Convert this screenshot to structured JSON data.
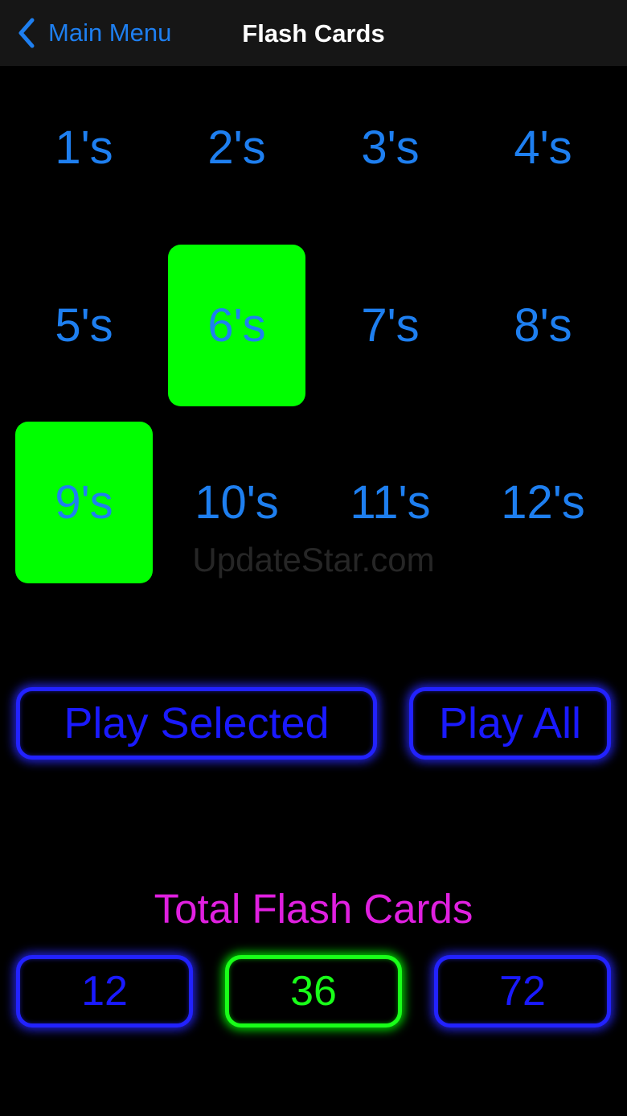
{
  "nav": {
    "back_label": "Main Menu",
    "back_icon": "chevron-left-icon",
    "title": "Flash Cards"
  },
  "tables": [
    {
      "label": "1's",
      "selected": false
    },
    {
      "label": "2's",
      "selected": false
    },
    {
      "label": "3's",
      "selected": false
    },
    {
      "label": "4's",
      "selected": false
    },
    {
      "label": "5's",
      "selected": false
    },
    {
      "label": "6's",
      "selected": true
    },
    {
      "label": "7's",
      "selected": false
    },
    {
      "label": "8's",
      "selected": false
    },
    {
      "label": "9's",
      "selected": true
    },
    {
      "label": "10's",
      "selected": false
    },
    {
      "label": "11's",
      "selected": false
    },
    {
      "label": "12's",
      "selected": false
    }
  ],
  "watermark": "UpdateStar.com",
  "actions": {
    "play_selected": "Play Selected",
    "play_all": "Play All"
  },
  "total": {
    "heading": "Total Flash Cards",
    "options": [
      {
        "value": "12",
        "active": false
      },
      {
        "value": "36",
        "active": true
      },
      {
        "value": "72",
        "active": false
      }
    ]
  },
  "colors": {
    "background": "#000000",
    "navbar": "#161616",
    "label_blue": "#1e7ff0",
    "selected_green": "#00ff00",
    "neon_blue": "#2222ff",
    "neon_green": "#19ff19",
    "heading_magenta": "#e020e0"
  }
}
